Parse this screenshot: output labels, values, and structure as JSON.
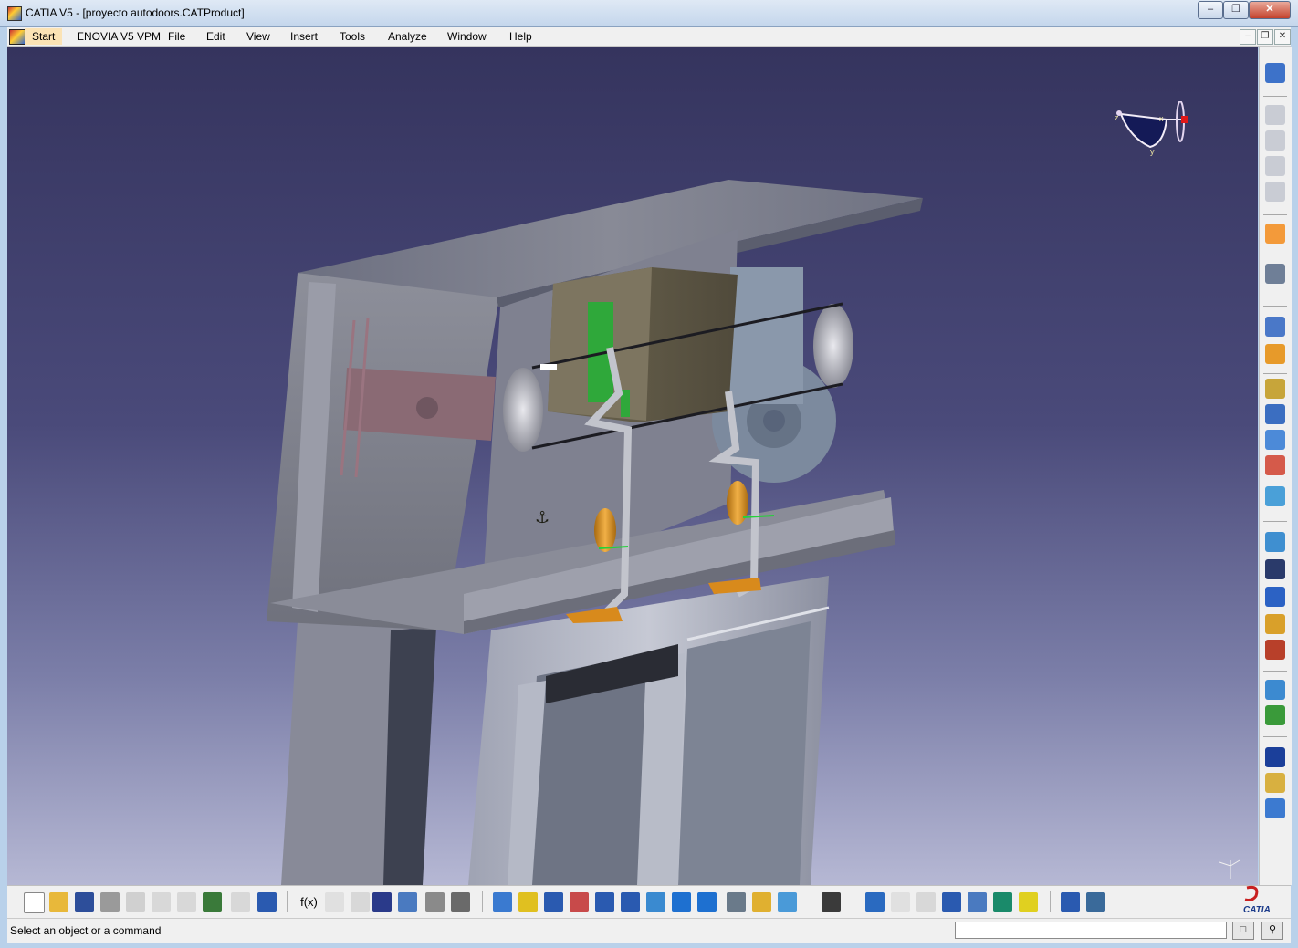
{
  "window": {
    "title": "CATIA V5 - [proyecto autodoors.CATProduct]"
  },
  "menubar": {
    "items": [
      "Start",
      "ENOVIA V5 VPM",
      "File",
      "Edit",
      "View",
      "Insert",
      "Tools",
      "Analyze",
      "Window",
      "Help"
    ]
  },
  "compass": {
    "x": "x",
    "y": "y",
    "z": "z"
  },
  "status": {
    "message": "Select an object or a command",
    "command_value": ""
  },
  "logo": {
    "text": "CATIA"
  },
  "icons": {
    "right_toolbar": [
      "spaceball-icon",
      "product-icon-1",
      "product-icon-2",
      "product-icon-3",
      "product-icon-4",
      "select-arrow-icon",
      "manipulation-icon",
      "snap-icon",
      "explode-icon",
      "constraint-icon",
      "fix-icon",
      "contact-icon",
      "offset-icon",
      "update-icon",
      "measure-icon",
      "scene-icon",
      "sequence-icon",
      "section-icon",
      "clash-icon",
      "distance-icon",
      "generative-icon",
      "catalog-icon",
      "swept-icon",
      "product-structure-icon",
      "knowledge-icon"
    ],
    "bottom_toolbar": [
      "new-icon",
      "open-icon",
      "save-icon",
      "print-icon",
      "cut-icon",
      "copy-icon",
      "paste-icon",
      "undo-icon",
      "redo-icon",
      "help-icon",
      "formula-icon",
      "comment-icon",
      "anchor-icon",
      "table-icon",
      "graph-icon",
      "bill-of-material-icon",
      "split-icon",
      "fly-icon",
      "fit-all-icon",
      "pan-icon",
      "rotate-icon",
      "zoom-in-icon",
      "zoom-out-icon",
      "normal-view-icon",
      "multiview-icon",
      "iso-view-icon",
      "shading-icon",
      "hide-show-icon",
      "swap-icon",
      "capture-icon",
      "analysis-icon",
      "first-icon",
      "last-icon",
      "search-icon",
      "catalog-browser-icon",
      "color-icon",
      "lamp-icon",
      "exchange-icon",
      "save-management-icon"
    ]
  }
}
